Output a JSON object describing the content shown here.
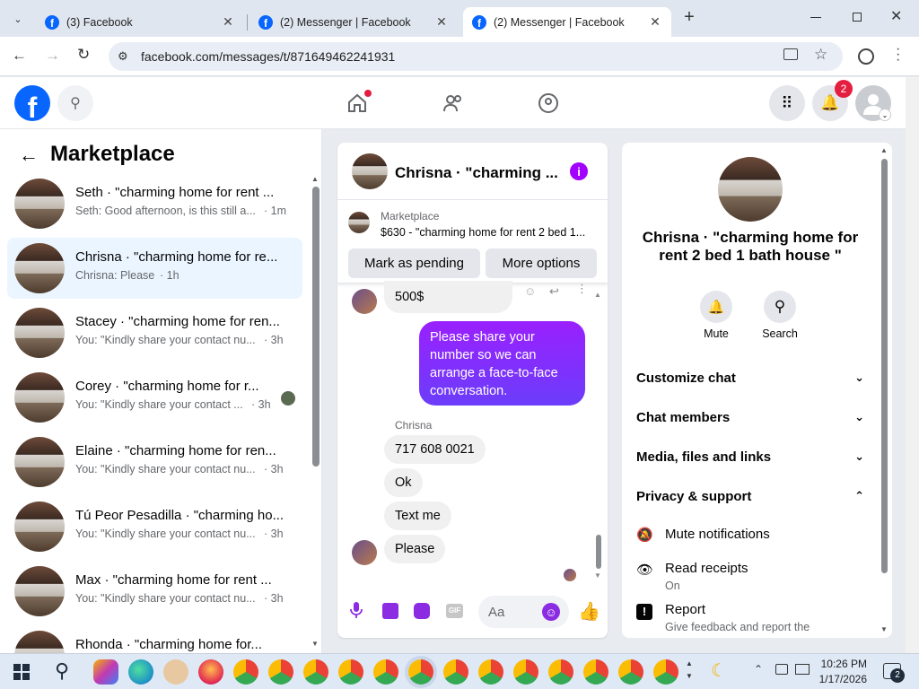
{
  "browser": {
    "tabs": [
      {
        "title": "(3) Facebook"
      },
      {
        "title": "(2) Messenger | Facebook"
      },
      {
        "title": "(2) Messenger | Facebook"
      }
    ],
    "url": "facebook.com/messages/t/871649462241931"
  },
  "header": {
    "notif_count": "2"
  },
  "sidebar": {
    "title": "Marketplace",
    "conversations": [
      {
        "name": "Seth · \"charming home for rent ...",
        "preview": "Seth: Good afternoon, is this still a...",
        "time": "· 1m"
      },
      {
        "name": "Chrisna · \"charming home for re...",
        "preview": "Chrisna: Please",
        "time": "· 1h"
      },
      {
        "name": "Stacey · \"charming home for ren...",
        "preview": "You: \"Kindly share your contact nu...",
        "time": "· 3h"
      },
      {
        "name": "Corey · \"charming home for r...",
        "preview": "You: \"Kindly share your contact ...",
        "time": "· 3h"
      },
      {
        "name": "Elaine · \"charming home for ren...",
        "preview": "You: \"Kindly share your contact nu...",
        "time": "· 3h"
      },
      {
        "name": "Tú Peor Pesadilla · \"charming ho...",
        "preview": "You: \"Kindly share your contact nu...",
        "time": "· 3h"
      },
      {
        "name": "Max · \"charming home for rent ...",
        "preview": "You: \"Kindly share your contact nu...",
        "time": "· 3h"
      },
      {
        "name": "Rhonda · \"charming home for...",
        "preview": "",
        "time": ""
      }
    ]
  },
  "chat": {
    "title": "Chrisna · \"charming ...",
    "listing": {
      "label": "Marketplace",
      "summary": "$630 - \"charming home for rent 2 bed 1..."
    },
    "buttons": {
      "mark_pending": "Mark as pending",
      "more_options": "More options"
    },
    "messages": {
      "partial": "500$",
      "sent": "Please share your number so we can arrange a face-to-face conversation.",
      "sender": "Chrisna",
      "received": [
        "717 608 0021",
        "Ok",
        "Text me",
        "Please"
      ]
    },
    "composer_placeholder": "Aa"
  },
  "info": {
    "name": "Chrisna · \"charming home for rent 2 bed 1 bath house \"",
    "actions": {
      "mute": "Mute",
      "search": "Search"
    },
    "sections": [
      "Customize chat",
      "Chat members",
      "Media, files and links",
      "Privacy & support"
    ],
    "privacy_items": [
      {
        "label": "Mute notifications",
        "sub": ""
      },
      {
        "label": "Read receipts",
        "sub": "On"
      },
      {
        "label": "Report",
        "sub": "Give feedback and report the"
      }
    ]
  },
  "taskbar": {
    "time": "10:26 PM",
    "date": "1/17/2026",
    "notif": "2"
  }
}
